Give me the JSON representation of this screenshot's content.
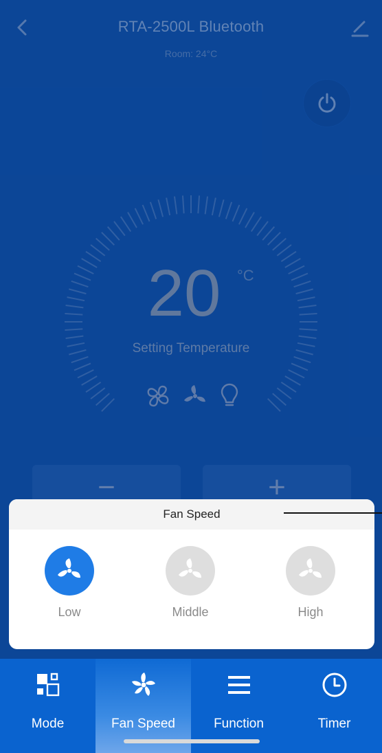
{
  "header": {
    "title": "RTA-2500L Bluetooth",
    "room": "Room: 24°C"
  },
  "thermostat": {
    "setpoint": "20",
    "unit": "°C",
    "label": "Setting Temperature",
    "minus_label": "−",
    "plus_label": "+"
  },
  "fan_speed_sheet": {
    "title": "Fan Speed",
    "selected": "Low",
    "options": [
      {
        "label": "Low"
      },
      {
        "label": "Middle"
      },
      {
        "label": "High"
      }
    ]
  },
  "tabbar": {
    "active": "Fan Speed",
    "tabs": [
      {
        "label": "Mode",
        "icon": "mode-icon"
      },
      {
        "label": "Fan Speed",
        "icon": "fan-icon"
      },
      {
        "label": "Function",
        "icon": "menu-icon"
      },
      {
        "label": "Timer",
        "icon": "clock-icon"
      }
    ]
  },
  "colors": {
    "background": "#0c4ba1",
    "accent": "#1f7ce6",
    "tabbar": "#0a63cf"
  }
}
